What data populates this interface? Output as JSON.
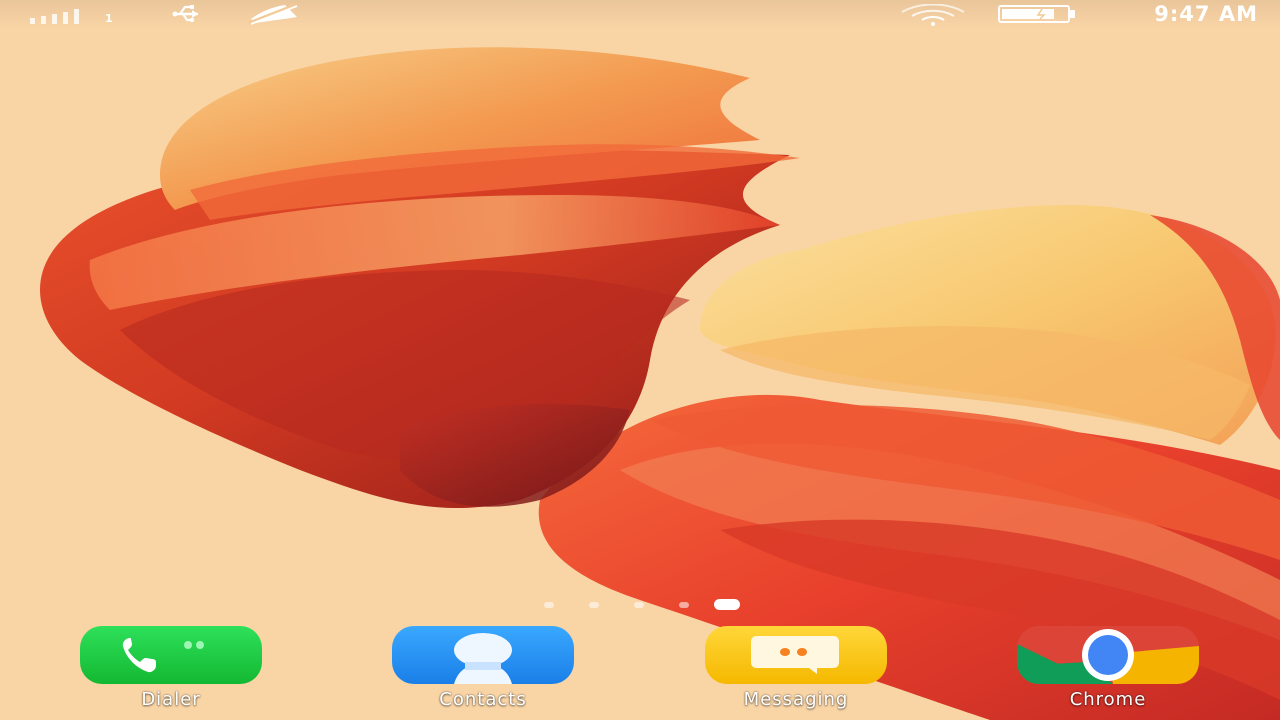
{
  "status_bar": {
    "time": "9:47 AM",
    "sim_number": "1",
    "icons": [
      "signal-icon",
      "usb-icon",
      "notification-muted-icon",
      "wifi-icon",
      "battery-icon"
    ]
  },
  "wallpaper": {
    "description_colors": {
      "background": "#f9d5a6",
      "deep_red": "#c8281e",
      "orange": "#f0602a",
      "yellow": "#f8c870"
    }
  },
  "page_indicator": {
    "count": 5,
    "active_index": 4
  },
  "dock": {
    "apps": [
      {
        "label": "Dialer",
        "icon": "phone-icon",
        "color": "#1ec83c"
      },
      {
        "label": "Contacts",
        "icon": "contact-icon",
        "color": "#1e90f0"
      },
      {
        "label": "Messaging",
        "icon": "message-icon",
        "color": "#f8c81c"
      },
      {
        "label": "Chrome",
        "icon": "chrome-icon",
        "color": "#db4437"
      }
    ]
  }
}
